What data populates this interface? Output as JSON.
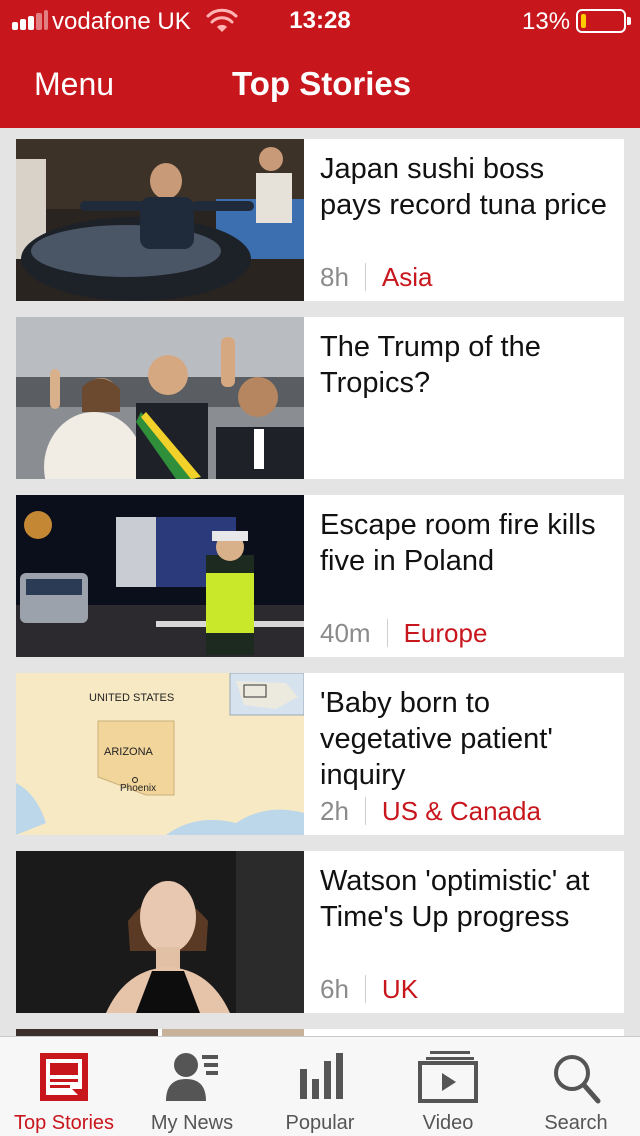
{
  "status_bar": {
    "carrier": "vodafone UK",
    "time": "13:28",
    "battery_percent_text": "13%",
    "battery_level": 0.13,
    "signal_bars": 3,
    "signal_bars_max": 5
  },
  "header": {
    "menu_label": "Menu",
    "title": "Top Stories"
  },
  "stories": [
    {
      "headline": "Japan sushi boss pays record tuna price",
      "time": "8h",
      "section": "Asia",
      "image": "sushi-boss-tuna-photo"
    },
    {
      "headline": "The Trump of the Tropics?",
      "time": "",
      "section": "",
      "image": "brazil-president-photo"
    },
    {
      "headline": "Escape room fire kills five in Poland",
      "time": "40m",
      "section": "Europe",
      "image": "poland-police-night-photo"
    },
    {
      "headline": "'Baby born to vegetative patient' inquiry",
      "time": "2h",
      "section": "US & Canada",
      "image": "arizona-map",
      "map_labels": {
        "country": "UNITED STATES",
        "state": "ARIZONA",
        "city": "Phoenix"
      }
    },
    {
      "headline": "Watson 'optimistic' at Time's Up progress",
      "time": "6h",
      "section": "UK",
      "image": "emma-watson-photo"
    }
  ],
  "tabs": [
    {
      "label": "Top Stories",
      "icon": "newspaper-icon",
      "active": true
    },
    {
      "label": "My News",
      "icon": "person-news-icon",
      "active": false
    },
    {
      "label": "Popular",
      "icon": "bar-chart-icon",
      "active": false
    },
    {
      "label": "Video",
      "icon": "video-play-icon",
      "active": false
    },
    {
      "label": "Search",
      "icon": "magnifier-icon",
      "active": false
    }
  ],
  "colors": {
    "brand_red": "#c8161d",
    "battery_low": "#ffcc00",
    "section_label": "#c8161d",
    "timestamp": "#8b8b8b"
  }
}
